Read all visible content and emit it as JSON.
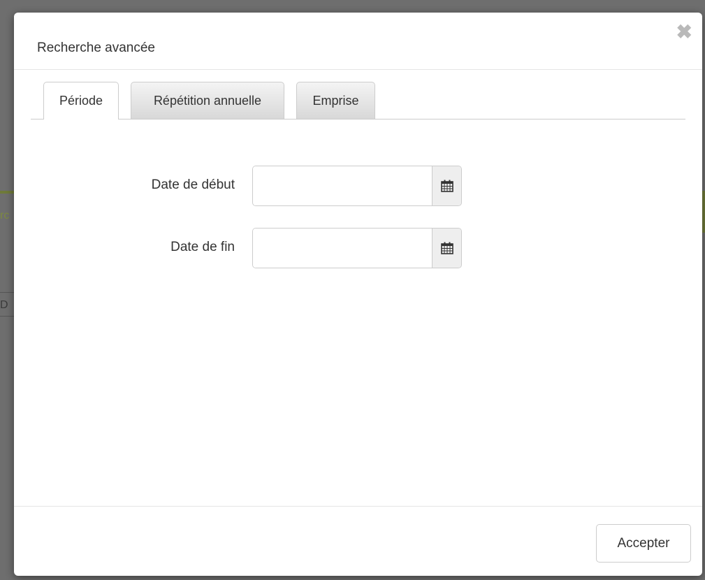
{
  "dialog": {
    "title": "Recherche avancée",
    "close_icon": "close-icon",
    "close_glyph": "✖"
  },
  "tabs": [
    {
      "label": "Période",
      "active": true
    },
    {
      "label": "Répétition annuelle",
      "active": false
    },
    {
      "label": "Emprise",
      "active": false
    }
  ],
  "form": {
    "start_date": {
      "label": "Date de début",
      "value": "",
      "icon": "calendar-icon"
    },
    "end_date": {
      "label": "Date de fin",
      "value": "",
      "icon": "calendar-icon"
    }
  },
  "footer": {
    "accept_label": "Accepter"
  },
  "colors": {
    "overlay": "#6e6e6e",
    "accent_bg": "#6f7a3a",
    "addon_bg": "#eeeeee",
    "border": "#cccccc",
    "text": "#333333"
  }
}
